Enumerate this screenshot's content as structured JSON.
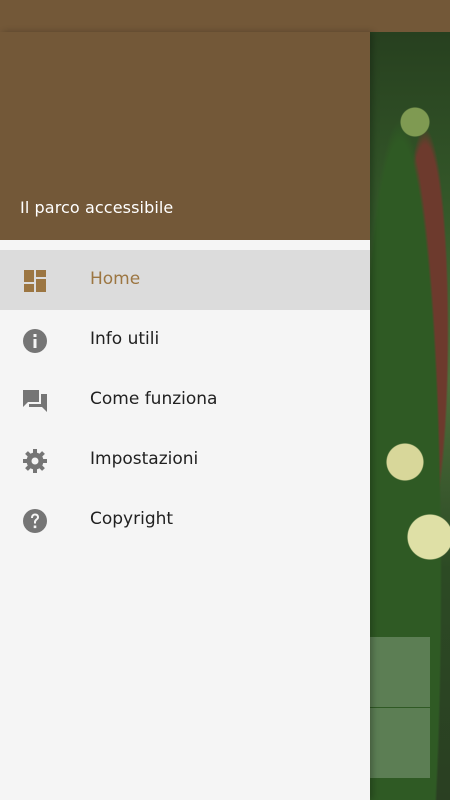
{
  "drawer": {
    "header_title": "Il parco accessibile"
  },
  "menu": {
    "items": [
      {
        "label": "Home",
        "icon": "dashboard-icon",
        "active": true
      },
      {
        "label": "Info utili",
        "icon": "info-icon",
        "active": false
      },
      {
        "label": "Come funziona",
        "icon": "chat-icon",
        "active": false
      },
      {
        "label": "Impostazioni",
        "icon": "gear-icon",
        "active": false
      },
      {
        "label": "Copyright",
        "icon": "help-icon",
        "active": false
      }
    ]
  },
  "colors": {
    "header_brown": "#735838",
    "active_accent": "#9c7642",
    "icon_gray": "#757575",
    "drawer_bg": "#f5f5f5",
    "active_bg": "#dcdcdc"
  }
}
